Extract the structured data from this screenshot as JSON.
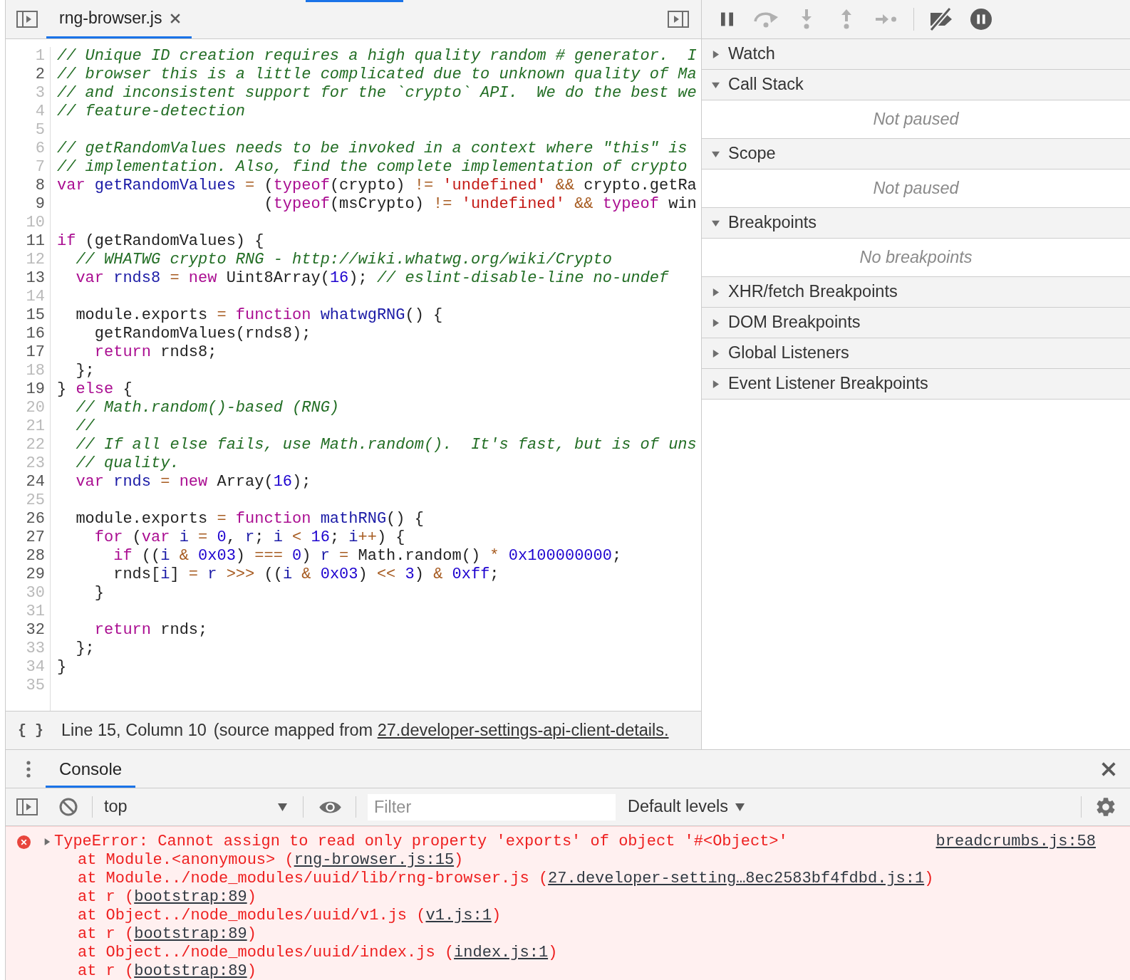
{
  "editor": {
    "tabs": [
      {
        "label": "rng-browser.js",
        "selected": true,
        "closable": true
      }
    ],
    "lines": [
      {
        "number": "1",
        "mapped": false,
        "tokens": [
          {
            "kind": "comment",
            "text": "// Unique ID creation requires a high quality random # generator.  I"
          }
        ]
      },
      {
        "number": "2",
        "mapped": true,
        "tokens": [
          {
            "kind": "comment",
            "text": "// browser this is a little complicated due to unknown quality of Ma"
          }
        ]
      },
      {
        "number": "3",
        "mapped": false,
        "tokens": [
          {
            "kind": "comment",
            "text": "// and inconsistent support for the `crypto` API.  We do the best we"
          }
        ]
      },
      {
        "number": "4",
        "mapped": false,
        "tokens": [
          {
            "kind": "comment",
            "text": "// feature-detection"
          }
        ]
      },
      {
        "number": "5",
        "mapped": false
      },
      {
        "number": "6",
        "mapped": false,
        "tokens": [
          {
            "kind": "comment",
            "text": "// getRandomValues needs to be invoked in a context where \"this\" is"
          }
        ]
      },
      {
        "number": "7",
        "mapped": false,
        "tokens": [
          {
            "kind": "comment",
            "text": "// implementation. Also, find the complete implementation of crypto"
          }
        ]
      },
      {
        "number": "8",
        "mapped": true,
        "tokens": [
          {
            "kind": "keyword",
            "text": "var"
          },
          {
            "kind": "def",
            "text": " getRandomValues"
          },
          {
            "kind": "operator",
            "text": " ="
          },
          {
            "kind": "plain",
            "text": " ("
          },
          {
            "kind": "keyword",
            "text": "typeof"
          },
          {
            "kind": "plain",
            "text": "(crypto) "
          },
          {
            "kind": "operator",
            "text": "!="
          },
          {
            "kind": "string",
            "text": " 'undefined'"
          },
          {
            "kind": "operator",
            "text": " &&"
          },
          {
            "kind": "plain",
            "text": " crypto.getRa"
          }
        ]
      },
      {
        "number": "9",
        "mapped": true,
        "tokens": [
          {
            "kind": "plain",
            "text": "                      ("
          },
          {
            "kind": "keyword",
            "text": "typeof"
          },
          {
            "kind": "plain",
            "text": "(msCrypto) "
          },
          {
            "kind": "operator",
            "text": "!="
          },
          {
            "kind": "string",
            "text": " 'undefined'"
          },
          {
            "kind": "operator",
            "text": " &&"
          },
          {
            "kind": "keyword",
            "text": " typeof"
          },
          {
            "kind": "plain",
            "text": " win"
          }
        ]
      },
      {
        "number": "10",
        "mapped": false
      },
      {
        "number": "11",
        "mapped": true,
        "tokens": [
          {
            "kind": "keyword",
            "text": "if"
          },
          {
            "kind": "plain",
            "text": " (getRandomValues) {"
          }
        ]
      },
      {
        "number": "12",
        "mapped": false,
        "tokens": [
          {
            "kind": "comment",
            "text": "  // WHATWG crypto RNG - http://wiki.whatwg.org/wiki/Crypto"
          }
        ]
      },
      {
        "number": "13",
        "mapped": true,
        "tokens": [
          {
            "kind": "keyword",
            "text": "  var"
          },
          {
            "kind": "def",
            "text": " rnds8"
          },
          {
            "kind": "operator",
            "text": " ="
          },
          {
            "kind": "keyword",
            "text": " new"
          },
          {
            "kind": "plain",
            "text": " Uint8Array("
          },
          {
            "kind": "number",
            "text": "16"
          },
          {
            "kind": "plain",
            "text": "); "
          },
          {
            "kind": "comment",
            "text": "// eslint-disable-line no-undef"
          }
        ]
      },
      {
        "number": "14",
        "mapped": false
      },
      {
        "number": "15",
        "mapped": true,
        "tokens": [
          {
            "kind": "plain",
            "text": "  module.exports "
          },
          {
            "kind": "operator",
            "text": "="
          },
          {
            "kind": "keyword",
            "text": " function"
          },
          {
            "kind": "def",
            "text": " whatwgRNG"
          },
          {
            "kind": "plain",
            "text": "() {"
          }
        ]
      },
      {
        "number": "16",
        "mapped": true,
        "tokens": [
          {
            "kind": "plain",
            "text": "    getRandomValues(rnds8);"
          }
        ]
      },
      {
        "number": "17",
        "mapped": true,
        "tokens": [
          {
            "kind": "keyword",
            "text": "    return"
          },
          {
            "kind": "plain",
            "text": " rnds8;"
          }
        ]
      },
      {
        "number": "18",
        "mapped": false,
        "tokens": [
          {
            "kind": "plain",
            "text": "  };"
          }
        ]
      },
      {
        "number": "19",
        "mapped": true,
        "tokens": [
          {
            "kind": "plain",
            "text": "} "
          },
          {
            "kind": "keyword",
            "text": "else"
          },
          {
            "kind": "plain",
            "text": " {"
          }
        ]
      },
      {
        "number": "20",
        "mapped": false,
        "tokens": [
          {
            "kind": "comment",
            "text": "  // Math.random()-based (RNG)"
          }
        ]
      },
      {
        "number": "21",
        "mapped": false,
        "tokens": [
          {
            "kind": "comment",
            "text": "  //"
          }
        ]
      },
      {
        "number": "22",
        "mapped": false,
        "tokens": [
          {
            "kind": "comment",
            "text": "  // If all else fails, use Math.random().  It's fast, but is of uns"
          }
        ]
      },
      {
        "number": "23",
        "mapped": false,
        "tokens": [
          {
            "kind": "comment",
            "text": "  // quality."
          }
        ]
      },
      {
        "number": "24",
        "mapped": true,
        "tokens": [
          {
            "kind": "keyword",
            "text": "  var"
          },
          {
            "kind": "def",
            "text": " rnds"
          },
          {
            "kind": "operator",
            "text": " ="
          },
          {
            "kind": "keyword",
            "text": " new"
          },
          {
            "kind": "plain",
            "text": " Array("
          },
          {
            "kind": "number",
            "text": "16"
          },
          {
            "kind": "plain",
            "text": ");"
          }
        ]
      },
      {
        "number": "25",
        "mapped": false
      },
      {
        "number": "26",
        "mapped": true,
        "tokens": [
          {
            "kind": "plain",
            "text": "  module.exports "
          },
          {
            "kind": "operator",
            "text": "="
          },
          {
            "kind": "keyword",
            "text": " function"
          },
          {
            "kind": "def",
            "text": " mathRNG"
          },
          {
            "kind": "plain",
            "text": "() {"
          }
        ]
      },
      {
        "number": "27",
        "mapped": true,
        "tokens": [
          {
            "kind": "keyword",
            "text": "    for"
          },
          {
            "kind": "plain",
            "text": " ("
          },
          {
            "kind": "keyword",
            "text": "var"
          },
          {
            "kind": "def",
            "text": " i"
          },
          {
            "kind": "operator",
            "text": " ="
          },
          {
            "kind": "number",
            "text": " 0"
          },
          {
            "kind": "plain",
            "text": ", "
          },
          {
            "kind": "def",
            "text": "r"
          },
          {
            "kind": "plain",
            "text": "; "
          },
          {
            "kind": "def",
            "text": "i"
          },
          {
            "kind": "operator",
            "text": " <"
          },
          {
            "kind": "number",
            "text": " 16"
          },
          {
            "kind": "plain",
            "text": "; "
          },
          {
            "kind": "def",
            "text": "i"
          },
          {
            "kind": "operator",
            "text": "++"
          },
          {
            "kind": "plain",
            "text": ") {"
          }
        ]
      },
      {
        "number": "28",
        "mapped": true,
        "tokens": [
          {
            "kind": "keyword",
            "text": "      if"
          },
          {
            "kind": "plain",
            "text": " (("
          },
          {
            "kind": "def",
            "text": "i"
          },
          {
            "kind": "operator",
            "text": " &"
          },
          {
            "kind": "number",
            "text": " 0x03"
          },
          {
            "kind": "plain",
            "text": ") "
          },
          {
            "kind": "operator",
            "text": "==="
          },
          {
            "kind": "number",
            "text": " 0"
          },
          {
            "kind": "plain",
            "text": ") "
          },
          {
            "kind": "def",
            "text": "r"
          },
          {
            "kind": "operator",
            "text": " ="
          },
          {
            "kind": "plain",
            "text": " Math.random() "
          },
          {
            "kind": "operator",
            "text": "*"
          },
          {
            "kind": "number",
            "text": " 0x100000000"
          },
          {
            "kind": "plain",
            "text": ";"
          }
        ]
      },
      {
        "number": "29",
        "mapped": true,
        "tokens": [
          {
            "kind": "plain",
            "text": "      rnds["
          },
          {
            "kind": "def",
            "text": "i"
          },
          {
            "kind": "plain",
            "text": "] "
          },
          {
            "kind": "operator",
            "text": "="
          },
          {
            "kind": "def",
            "text": " r"
          },
          {
            "kind": "operator",
            "text": " >>>"
          },
          {
            "kind": "plain",
            "text": " (("
          },
          {
            "kind": "def",
            "text": "i"
          },
          {
            "kind": "operator",
            "text": " &"
          },
          {
            "kind": "number",
            "text": " 0x03"
          },
          {
            "kind": "plain",
            "text": ") "
          },
          {
            "kind": "operator",
            "text": "<<"
          },
          {
            "kind": "number",
            "text": " 3"
          },
          {
            "kind": "plain",
            "text": ") "
          },
          {
            "kind": "operator",
            "text": "&"
          },
          {
            "kind": "number",
            "text": " 0xff"
          },
          {
            "kind": "plain",
            "text": ";"
          }
        ]
      },
      {
        "number": "30",
        "mapped": false,
        "tokens": [
          {
            "kind": "plain",
            "text": "    }"
          }
        ]
      },
      {
        "number": "31",
        "mapped": false
      },
      {
        "number": "32",
        "mapped": true,
        "tokens": [
          {
            "kind": "keyword",
            "text": "    return"
          },
          {
            "kind": "plain",
            "text": " rnds;"
          }
        ]
      },
      {
        "number": "33",
        "mapped": false,
        "tokens": [
          {
            "kind": "plain",
            "text": "  };"
          }
        ]
      },
      {
        "number": "34",
        "mapped": false,
        "tokens": [
          {
            "kind": "plain",
            "text": "}"
          }
        ]
      },
      {
        "number": "35",
        "mapped": false
      }
    ],
    "status_bar": {
      "pretty_print": "{ }",
      "position": "Line 15, Column 10",
      "source_prefix": "(source mapped from ",
      "source_link": "27.developer-settings-api-client-details."
    }
  },
  "debugger_toolbar": [
    {
      "kind": "pause",
      "disabled": false
    },
    {
      "kind": "step_over",
      "disabled": true
    },
    {
      "kind": "step_into",
      "disabled": true
    },
    {
      "kind": "step_out",
      "disabled": true
    },
    {
      "kind": "step",
      "disabled": true
    },
    {
      "kind": "deactivate_breakpoints",
      "disabled": false
    },
    {
      "kind": "pause_on_exceptions",
      "disabled": false
    }
  ],
  "sidebar": {
    "sections": [
      {
        "title": "Watch",
        "expanded": false
      },
      {
        "title": "Call Stack",
        "expanded": true,
        "message": "Not paused"
      },
      {
        "title": "Scope",
        "expanded": true,
        "message": "Not paused"
      },
      {
        "title": "Breakpoints",
        "expanded": true,
        "message": "No breakpoints"
      },
      {
        "title": "XHR/fetch Breakpoints",
        "expanded": false
      },
      {
        "title": "DOM Breakpoints",
        "expanded": false
      },
      {
        "title": "Global Listeners",
        "expanded": false
      },
      {
        "title": "Event Listener Breakpoints",
        "expanded": false
      }
    ]
  },
  "drawer": {
    "tabs": [
      {
        "label": "Console",
        "selected": true
      }
    ],
    "toolbar": {
      "context": "top",
      "filter": {
        "placeholder": "Filter"
      },
      "levels": "Default levels"
    },
    "messages": [
      {
        "kind": "error",
        "expanded": false,
        "text": "TypeError: Cannot assign to read only property 'exports' of object '#<Object>'",
        "source": "breadcrumbs.js:58",
        "stack": [
          {
            "before": "at Module.<anonymous> (",
            "link": "rng-browser.js:15",
            "after": ")"
          },
          {
            "before": "at Module../node_modules/uuid/lib/rng-browser.js (",
            "link": "27.developer-setting…8ec2583bf4fdbd.js:1",
            "after": ")"
          },
          {
            "before": "at r (",
            "link": "bootstrap:89",
            "after": ")"
          },
          {
            "before": "at Object../node_modules/uuid/v1.js (",
            "link": "v1.js:1",
            "after": ")"
          },
          {
            "before": "at r (",
            "link": "bootstrap:89",
            "after": ")"
          },
          {
            "before": "at Object../node_modules/uuid/index.js (",
            "link": "index.js:1",
            "after": ")"
          },
          {
            "before": "at r (",
            "link": "bootstrap:89",
            "after": ")"
          }
        ]
      }
    ]
  }
}
